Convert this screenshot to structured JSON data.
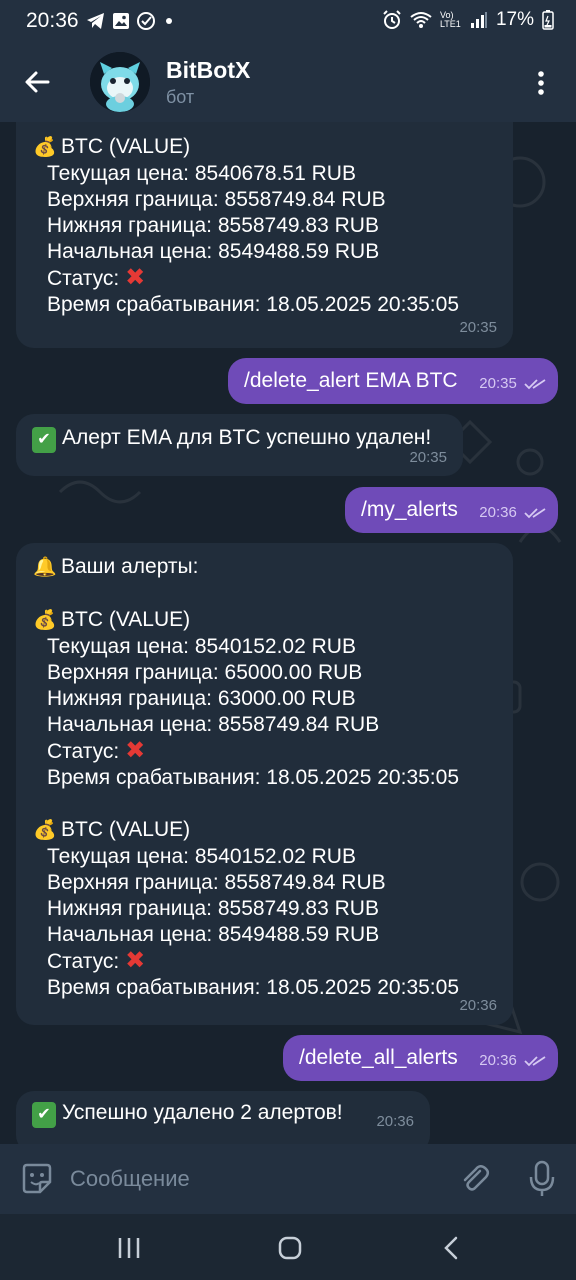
{
  "status_bar": {
    "time": "20:36",
    "battery": "17%",
    "network": "Vo) LTE1"
  },
  "header": {
    "title": "BitBotX",
    "subtitle": "бот"
  },
  "messages": {
    "m1": {
      "title": "BTC (VALUE)",
      "lines": [
        "Текущая цена: 8540678.51 RUB",
        "Верхняя граница: 8558749.84 RUB",
        "Нижняя граница: 8558749.83 RUB",
        "Начальная цена: 8549488.59 RUB",
        "Статус:",
        "Время срабатывания: 18.05.2025 20:35:05"
      ],
      "time": "20:35"
    },
    "m2": {
      "text": "/delete_alert EMA BTC",
      "time": "20:35"
    },
    "m3": {
      "text": "Алерт EMA для BTC успешно удален!",
      "time": "20:35"
    },
    "m4": {
      "text": "/my_alerts",
      "time": "20:36"
    },
    "m5": {
      "heading": "Ваши алерты:",
      "alert1": {
        "title": "BTC (VALUE)",
        "lines": [
          "Текущая цена: 8540152.02 RUB",
          "Верхняя граница: 65000.00 RUB",
          "Нижняя граница: 63000.00 RUB",
          "Начальная цена: 8558749.84 RUB",
          "Статус:",
          "Время срабатывания: 18.05.2025 20:35:05"
        ]
      },
      "alert2": {
        "title": "BTC (VALUE)",
        "lines": [
          "Текущая цена: 8540152.02 RUB",
          "Верхняя граница: 8558749.84 RUB",
          "Нижняя граница: 8558749.83 RUB",
          "Начальная цена: 8549488.59 RUB",
          "Статус:",
          "Время срабатывания: 18.05.2025 20:35:05"
        ]
      },
      "time": "20:36"
    },
    "m6": {
      "text": "/delete_all_alerts",
      "time": "20:36"
    },
    "m7": {
      "text": "Успешно удалено 2 алертов!",
      "time": "20:36"
    }
  },
  "input": {
    "placeholder": "Сообщение"
  },
  "colors": {
    "outgoing": "#6f4bb8",
    "incoming": "#212d3b",
    "header": "#233040",
    "error": "#e53935",
    "success": "#43a047"
  }
}
